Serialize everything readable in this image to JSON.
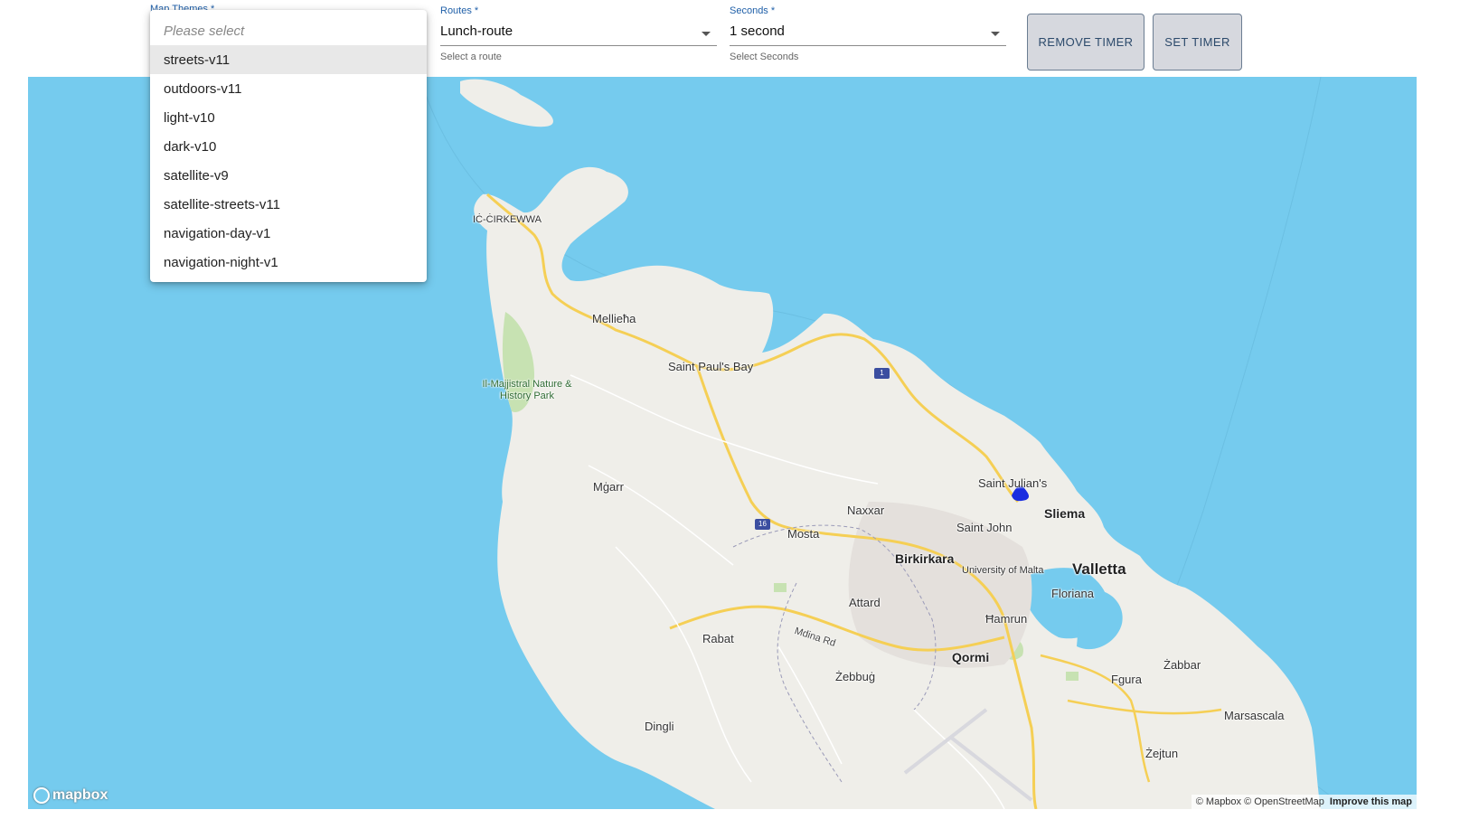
{
  "controls": {
    "map_themes": {
      "label": "Map Themes *",
      "placeholder": "Please select",
      "options": [
        "streets-v11",
        "outdoors-v11",
        "light-v10",
        "dark-v10",
        "satellite-v9",
        "satellite-streets-v11",
        "navigation-day-v1",
        "navigation-night-v1"
      ],
      "highlighted": "streets-v11"
    },
    "routes": {
      "label": "Routes *",
      "value": "Lunch-route",
      "helper": "Select a route"
    },
    "seconds": {
      "label": "Seconds *",
      "value": "1 second",
      "helper": "Select Seconds"
    },
    "remove_timer": "REMOVE TIMER",
    "set_timer": "SET TIMER"
  },
  "map": {
    "places": {
      "cirkewwa": "IĊ-ĊIRKEWWA",
      "mellieha": "Mellieħa",
      "saint_pauls_bay": "Saint Paul's Bay",
      "majjistral": "Il-Majjistral Nature & History Park",
      "mgarr": "Mġarr",
      "naxxar": "Naxxar",
      "mosta": "Mosta",
      "saint_julians": "Saint Julian's",
      "sliema": "Sliema",
      "saint_john": "Saint John",
      "birkirkara": "Birkirkara",
      "university": "University of Malta",
      "valletta": "Valletta",
      "floriana": "Floriana",
      "attard": "Attard",
      "hamrun": "Ħamrun",
      "rabat": "Rabat",
      "mdina_rd": "Mdina Rd",
      "qormi": "Qormi",
      "zabbar": "Żabbar",
      "fgura": "Fgura",
      "zebbug": "Żebbuġ",
      "marsascala": "Marsascala",
      "dingli": "Dingli",
      "zejtun": "Żejtun"
    },
    "road_badges": {
      "r1": "1",
      "r16": "16"
    },
    "logo": "mapbox",
    "attribution": {
      "copyright": "© Mapbox © OpenStreetMap",
      "improve": "Improve this map"
    },
    "colors": {
      "water": "#75cbee",
      "land": "#efeee9",
      "park": "#c7e2b2",
      "main_road": "#f5cf55",
      "route": "#1a2de0"
    }
  }
}
